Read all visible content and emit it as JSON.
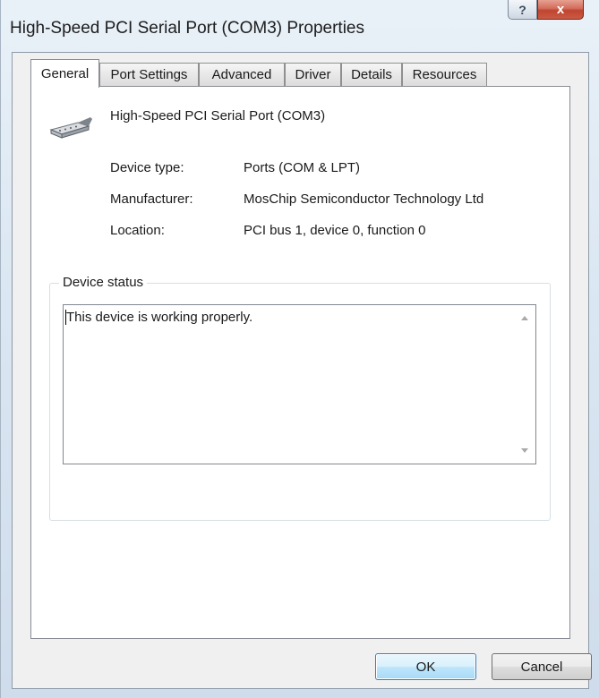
{
  "window": {
    "title": "High-Speed PCI Serial Port (COM3) Properties",
    "help_label": "?",
    "close_label": "x"
  },
  "tabs": [
    {
      "label": "General",
      "active": true
    },
    {
      "label": "Port Settings",
      "active": false
    },
    {
      "label": "Advanced",
      "active": false
    },
    {
      "label": "Driver",
      "active": false
    },
    {
      "label": "Details",
      "active": false
    },
    {
      "label": "Resources",
      "active": false
    }
  ],
  "general": {
    "device_icon": "serial-port-icon",
    "device_name": "High-Speed PCI Serial Port (COM3)",
    "properties": [
      {
        "label": "Device type:",
        "value": "Ports (COM & LPT)"
      },
      {
        "label": "Manufacturer:",
        "value": "MosChip Semiconductor Technology Ltd"
      },
      {
        "label": "Location:",
        "value": "PCI bus 1, device 0, function 0"
      }
    ],
    "status_group_title": "Device status",
    "status_text": "This device is working properly."
  },
  "buttons": {
    "ok_label": "OK",
    "cancel_label": "Cancel"
  },
  "colors": {
    "default_button_border": "#3c7fb1",
    "close_button": "#c04530"
  }
}
